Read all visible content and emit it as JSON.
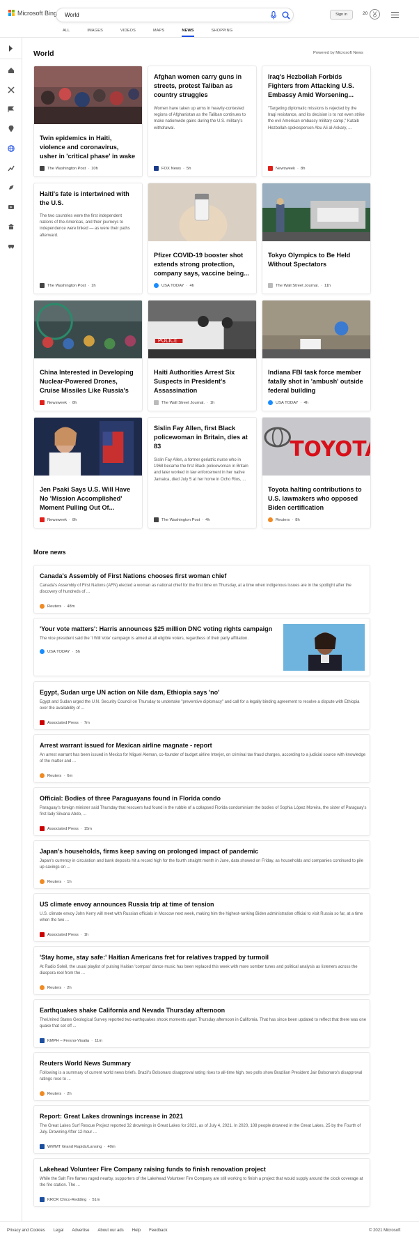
{
  "header": {
    "logo_text": "Microsoft Bing",
    "search_value": "World",
    "signin_label": "Sign in",
    "points": "20"
  },
  "tabs": [
    {
      "label": "ALL"
    },
    {
      "label": "IMAGES"
    },
    {
      "label": "VIDEOS"
    },
    {
      "label": "MAPS"
    },
    {
      "label": "NEWS",
      "active": true
    },
    {
      "label": "SHOPPING"
    }
  ],
  "section": {
    "title": "World",
    "powered": "Powered by Microsoft News",
    "more_title": "More news"
  },
  "cards": [
    {
      "title": "Twin epidemics in Haiti, violence and coronavirus, usher in 'critical phase' in wake of...",
      "desc": "",
      "source": "The Washington Post",
      "time": "10h",
      "src_color": "#444"
    },
    {
      "title": "Afghan women carry guns in streets, protest Taliban as country struggles",
      "desc": "Women have taken up arms in heavily-contested regions of Afghanistan as the Taliban continues to make nationwide gains during the U.S. military's withdrawal.",
      "source": "FOX News",
      "time": "5h",
      "src_color": "#1a3a8a"
    },
    {
      "title": "Iraq's Hezbollah Forbids Fighters from Attacking U.S. Embassy Amid Worsening...",
      "desc": "\"Targeting diplomatic missions is rejected by the Iraqi resistance, and its decision is to not even strike the evil American embassy military camp,\" Kataib Hezbollah spokesperson Abu Ali al-Askary, ...",
      "source": "Newsweek",
      "time": "8h",
      "src_color": "#e0201b"
    },
    {
      "title": "Haiti's fate is intertwined with the U.S.",
      "desc": "The two countries were the first independent nations of the Americas, and their journeys to independence were linked — as were their paths afterward.",
      "source": "The Washington Post",
      "time": "1h",
      "src_color": "#444"
    },
    {
      "title": "Pfizer COVID-19 booster shot extends strong protection, company says, vaccine being...",
      "desc": "",
      "source": "USA TODAY",
      "time": "4h",
      "src_color": "#1a8cff"
    },
    {
      "title": "Tokyo Olympics to Be Held Without Spectators",
      "desc": "",
      "source": "The Wall Street Journal.",
      "time": "11h",
      "src_color": "#999"
    },
    {
      "title": "China Interested in Developing Nuclear-Powered Drones, Cruise Missiles Like Russia's",
      "desc": "",
      "source": "Newsweek",
      "time": "8h",
      "src_color": "#e0201b"
    },
    {
      "title": "Haiti Authorities Arrest Six Suspects in President's Assassination",
      "desc": "",
      "source": "The Wall Street Journal.",
      "time": "1h",
      "src_color": "#999"
    },
    {
      "title": "Indiana FBI task force member fatally shot in 'ambush' outside federal building",
      "desc": "",
      "source": "USA TODAY",
      "time": "4h",
      "src_color": "#1a8cff"
    },
    {
      "title": "Jen Psaki Says U.S. Will Have No 'Mission Accomplished' Moment Pulling Out Of...",
      "desc": "",
      "source": "Newsweek",
      "time": "8h",
      "src_color": "#e0201b"
    },
    {
      "title": "Sislin Fay Allen, first Black policewoman in Britain, dies at 83",
      "desc": "Sislin Fay Allen, a former geriatric nurse who in 1968 became the first Black policewoman in Britain and later worked in law enforcement in her native Jamaica, died July 5 at her home in Ocho Rios, ...",
      "source": "The Washington Post",
      "time": "4h",
      "src_color": "#444"
    },
    {
      "title": "Toyota halting contributions to U.S. lawmakers who opposed Biden certification",
      "desc": "",
      "source": "Reuters",
      "time": "8h",
      "src_color": "#f08a24"
    }
  ],
  "more_news": [
    {
      "title": "Canada's Assembly of First Nations chooses first woman chief",
      "desc": "Canada's Assembly of First Nations (AFN) elected a woman as national chief for the first time on Thursday, at a time when indigenous issues are in the spotlight after the discovery of hundreds of ...",
      "source": "Reuters",
      "time": "48m",
      "src_color": "#f08a24"
    },
    {
      "title": "'Your vote matters': Harris announces $25 million DNC voting rights campaign",
      "desc": "The vice president said the 'I Will Vote' campaign is aimed at all eligible voters, regardless of their party affiliation.",
      "source": "USA TODAY",
      "time": "5h",
      "src_color": "#1a8cff"
    },
    {
      "title": "Egypt, Sudan urge UN action on Nile dam, Ethiopia says 'no'",
      "desc": "Egypt and Sudan urged the U.N. Security Council on Thursday to undertake \"preventive diplomacy\" and call for a legally binding agreement to resolve a dispute with Ethiopia over the availability of ...",
      "source": "Associated Press",
      "time": "7m",
      "src_color": "#c00"
    },
    {
      "title": "Arrest warrant issued for Mexican airline magnate - report",
      "desc": "An arrest warrant has been issued in Mexico for Miguel Aleman, co-founder of budget airline Interjet, on criminal tax fraud charges, according to a judicial source with knowledge of the matter and ...",
      "source": "Reuters",
      "time": "6m",
      "src_color": "#f08a24"
    },
    {
      "title": "Official: Bodies of three Paraguayans found in Florida condo",
      "desc": "Paraguay's foreign minister said Thursday that rescuers had found in the rubble of a collapsed Florida condominium the bodies of Sophia López Moreira, the sister of Paraguay's first lady Silvana Abdo, ...",
      "source": "Associated Press",
      "time": "15m",
      "src_color": "#c00"
    },
    {
      "title": "Japan's households, firms keep saving on prolonged impact of pandemic",
      "desc": "Japan's currency in circulation and bank deposits hit a record high for the fourth straight month in June, data showed on Friday, as households and companies continued to pile up savings on ...",
      "source": "Reuters",
      "time": "1h",
      "src_color": "#f08a24"
    },
    {
      "title": "US climate envoy announces Russia trip at time of tension",
      "desc": "U.S. climate envoy John Kerry will meet with Russian officials in Moscow next week, making him the highest-ranking Biden administration official to visit Russia so far, at a time when the two ...",
      "source": "Associated Press",
      "time": "1h",
      "src_color": "#c00"
    },
    {
      "title": "'Stay home, stay safe:' Haitian Americans fret for relatives trapped by turmoil",
      "desc": "At Radio Soleil, the usual playlist of pulsing Haitian 'compas' dance music has been replaced this week with more somber tunes and political analysis as listeners across the diaspora reel from the ...",
      "source": "Reuters",
      "time": "2h",
      "src_color": "#f08a24"
    },
    {
      "title": "Earthquakes shake California and Nevada Thursday afternoon",
      "desc": "TheUnited States Geological Survey reported two earthquakes shook moments apart Thursday afternoon in California. That has since been updated to reflect that there was one quake that set off ...",
      "source": "KMPH – Fresno-Visalia",
      "time": "11m",
      "src_color": "#1d4fa0"
    },
    {
      "title": "Reuters World News Summary",
      "desc": "Following is a summary of current world news briefs. Brazil's Bolsonaro disapproval rating rises to all-time high, two polls show Brazilian President Jair Bolsonaro's disapproval ratings rose to ...",
      "source": "Reuters",
      "time": "2h",
      "src_color": "#f08a24"
    },
    {
      "title": "Report: Great Lakes drownings increase in 2021",
      "desc": "The Great Lakes Surf Rescue Project reported 32 drownings in Great Lakes for 2021, as of July 4, 2021. In 2020, 108 people drowned in the Great Lakes, 25 by the Fourth of July. Drowning After 12-hour ...",
      "source": "WWMT Grand Rapids/Lansing",
      "time": "40m",
      "src_color": "#1d4fa0"
    },
    {
      "title": "Lakehead Volunteer Fire Company raising funds to finish renovation project",
      "desc": "While the Salt Fire flames raged nearby, supporters of the Lakehead Volunteer Fire Company are still working to finish a project that would supply around the clock coverage at the fire station. The ...",
      "source": "KRCR Chico-Redding",
      "time": "51m",
      "src_color": "#1d4fa0"
    }
  ],
  "footer": {
    "links": [
      "Privacy and Cookies",
      "Legal",
      "Advertise",
      "About our ads",
      "Help",
      "Feedback"
    ],
    "copyright": "© 2021 Microsoft"
  }
}
